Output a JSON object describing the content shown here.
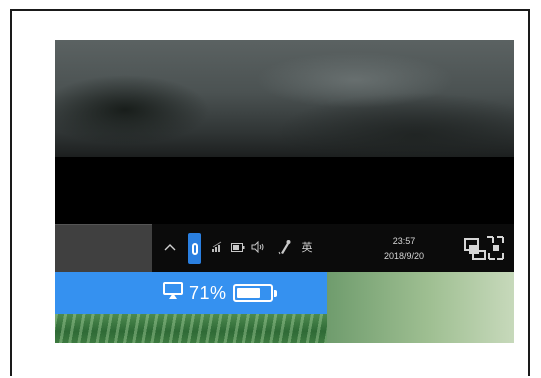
{
  "taskbar": {
    "tray": {
      "show_hidden_icon": "chevron-up-icon",
      "icons": [
        "bluetooth-icon",
        "network-icon",
        "battery-icon",
        "volume-icon",
        "pen-icon",
        "ime-icon"
      ],
      "ime_label": "英",
      "time": "23:57",
      "date": "2018/9/20",
      "action_center_icon": "notification-icon"
    }
  },
  "battery_bar": {
    "icon": "cast-icon",
    "percent_label": "71%",
    "percent": 71
  },
  "colors": {
    "accent_blue": "#3591f0",
    "bluetooth_highlight": "#2a7fe0",
    "taskbar": "#0b0b0b"
  }
}
